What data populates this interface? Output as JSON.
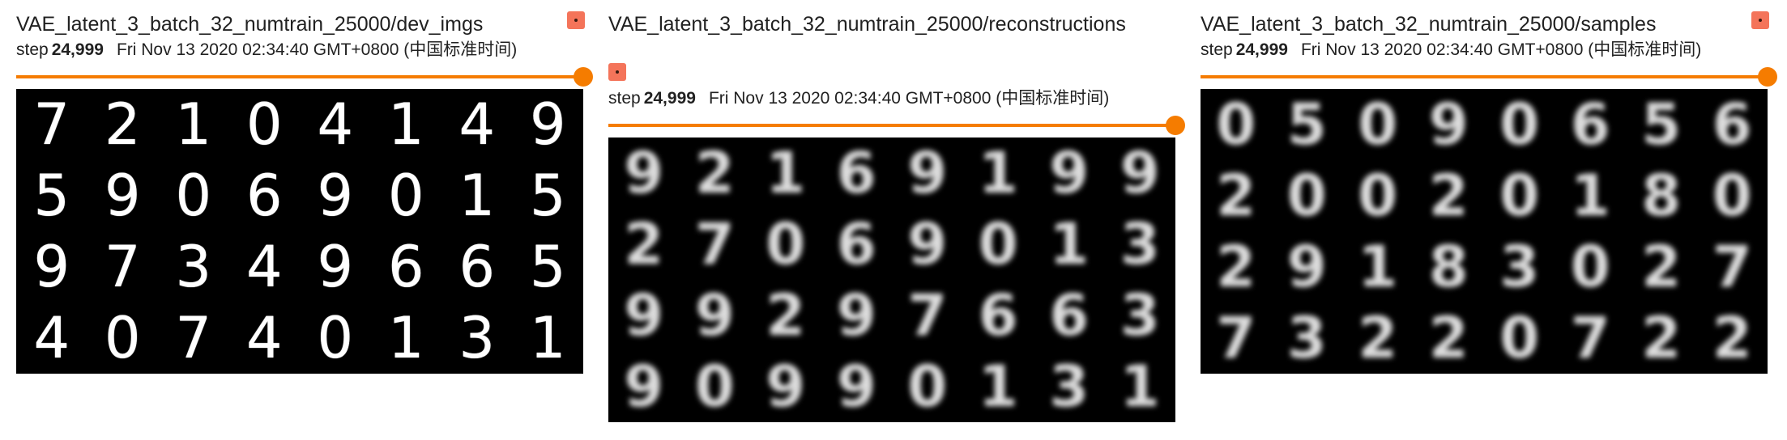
{
  "panels": [
    {
      "title": "VAE_latent_3_batch_32_numtrain_25000/dev_imgs",
      "step_label": "step",
      "step_value": "24,999",
      "timestamp": "Fri Nov 13 2020 02:34:40 GMT+0800 (中国标准时间)",
      "slider_fraction": 1.0,
      "style": "sharp",
      "digits": [
        "7",
        "2",
        "1",
        "0",
        "4",
        "1",
        "4",
        "9",
        "5",
        "9",
        "0",
        "6",
        "9",
        "0",
        "1",
        "5",
        "9",
        "7",
        "3",
        "4",
        "9",
        "6",
        "6",
        "5",
        "4",
        "0",
        "7",
        "4",
        "0",
        "1",
        "3",
        "1"
      ]
    },
    {
      "title": "VAE_latent_3_batch_32_numtrain_25000/reconstructions",
      "step_label": "step",
      "step_value": "24,999",
      "timestamp": "Fri Nov 13 2020 02:34:40 GMT+0800 (中国标准时间)",
      "slider_fraction": 1.0,
      "style": "blurry",
      "digits": [
        "9",
        "2",
        "1",
        "6",
        "9",
        "1",
        "9",
        "9",
        "2",
        "7",
        "0",
        "6",
        "9",
        "0",
        "1",
        "3",
        "9",
        "9",
        "2",
        "9",
        "7",
        "6",
        "6",
        "3",
        "9",
        "0",
        "9",
        "9",
        "0",
        "1",
        "3",
        "1"
      ]
    },
    {
      "title": "VAE_latent_3_batch_32_numtrain_25000/samples",
      "step_label": "step",
      "step_value": "24,999",
      "timestamp": "Fri Nov 13 2020 02:34:40 GMT+0800 (中国标准时间)",
      "slider_fraction": 1.0,
      "style": "blurry",
      "digits": [
        "0",
        "5",
        "0",
        "9",
        "0",
        "6",
        "5",
        "6",
        "2",
        "0",
        "0",
        "2",
        "0",
        "1",
        "8",
        "0",
        "2",
        "9",
        "1",
        "8",
        "3",
        "0",
        "2",
        "7",
        "7",
        "3",
        "2",
        "2",
        "0",
        "7",
        "2",
        "2"
      ]
    }
  ],
  "colors": {
    "accent": "#f57c00",
    "expand_button": "#f4745a",
    "image_background": "#000000"
  },
  "icons": {
    "expand": "expand-icon"
  }
}
